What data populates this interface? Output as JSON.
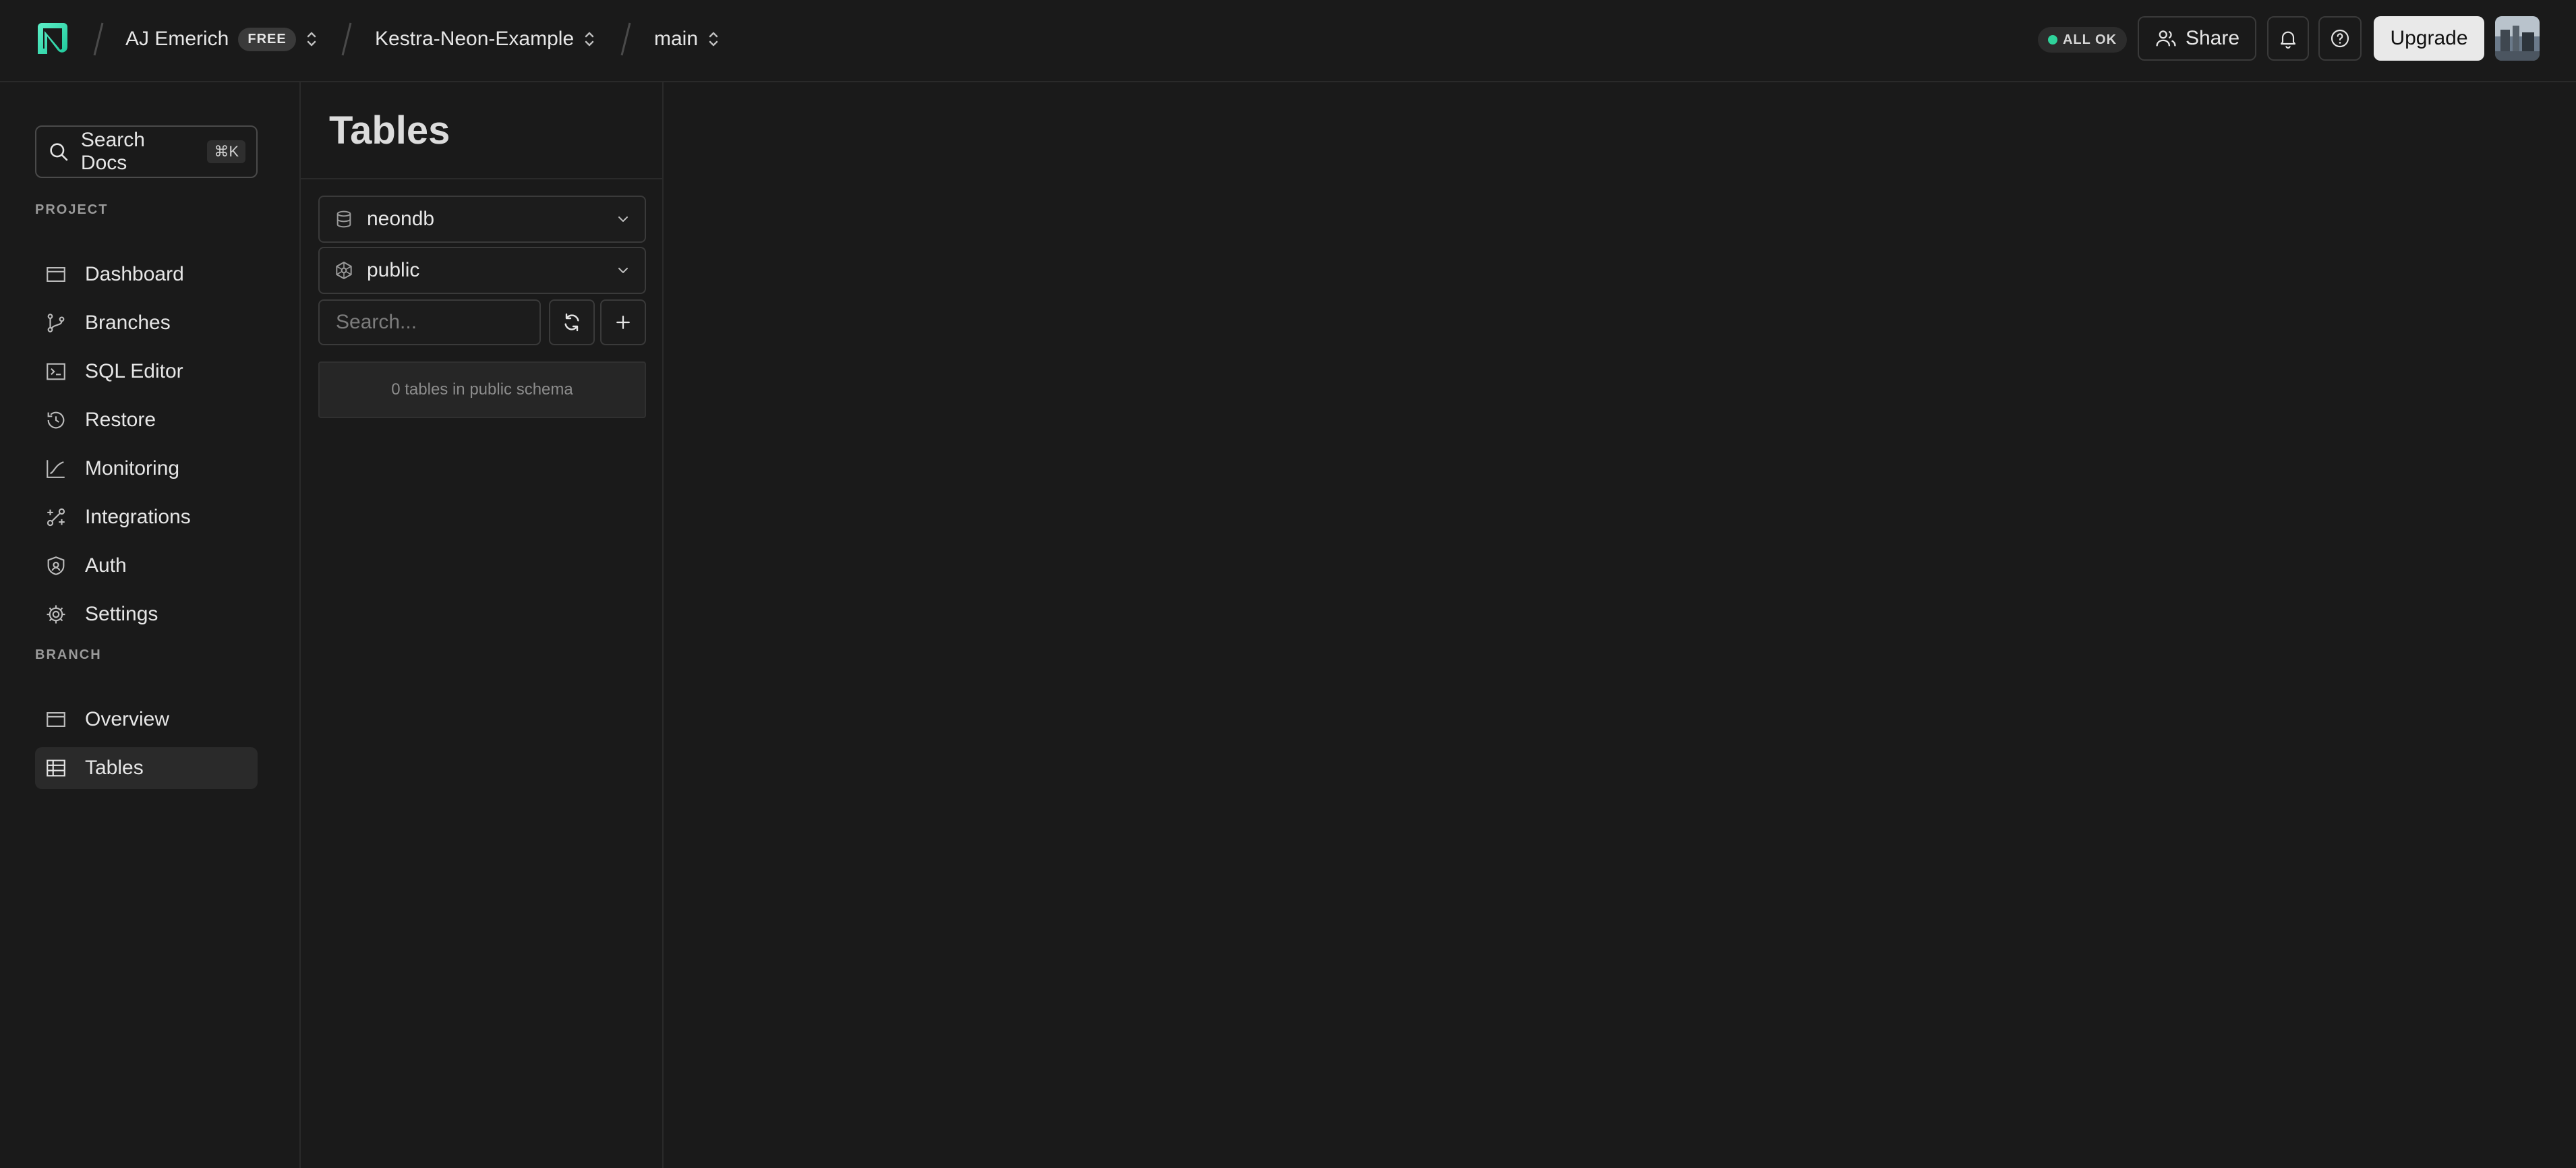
{
  "header": {
    "org_name": "AJ Emerich",
    "plan_badge": "FREE",
    "project_name": "Kestra-Neon-Example",
    "branch_name": "main",
    "status_text": "ALL OK",
    "share_label": "Share",
    "upgrade_label": "Upgrade"
  },
  "sidebar": {
    "search_label": "Search Docs",
    "search_shortcut": "⌘K",
    "project_section": "PROJECT",
    "project_items": [
      {
        "label": "Dashboard",
        "icon": "dashboard-icon"
      },
      {
        "label": "Branches",
        "icon": "branches-icon"
      },
      {
        "label": "SQL Editor",
        "icon": "sql-editor-icon"
      },
      {
        "label": "Restore",
        "icon": "restore-icon"
      },
      {
        "label": "Monitoring",
        "icon": "monitoring-icon"
      },
      {
        "label": "Integrations",
        "icon": "integrations-icon"
      },
      {
        "label": "Auth",
        "icon": "auth-icon"
      },
      {
        "label": "Settings",
        "icon": "gear-icon"
      }
    ],
    "branch_section": "BRANCH",
    "branch_items": [
      {
        "label": "Overview",
        "icon": "overview-icon"
      },
      {
        "label": "Tables",
        "icon": "tables-icon",
        "active": true
      }
    ]
  },
  "tables_panel": {
    "title": "Tables",
    "database_select": "neondb",
    "schema_select": "public",
    "search_placeholder": "Search...",
    "empty_message": "0 tables in public schema"
  },
  "colors": {
    "background": "#1a1a1a",
    "brand_accent": "#2fe0b0",
    "status_ok": "#2fd39b"
  }
}
